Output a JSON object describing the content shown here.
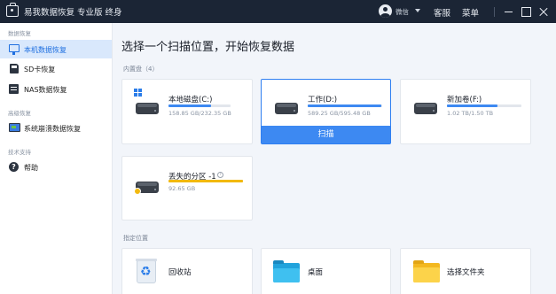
{
  "titlebar": {
    "app_title": "易我数据恢复 专业版 终身",
    "user_name": "微信",
    "links": [
      "客服",
      "菜单"
    ]
  },
  "sidebar": {
    "sections": [
      "数据恢复",
      "高级恢复",
      "技术支持"
    ],
    "items": [
      {
        "label": "本机数据恢复",
        "icon": "computer-icon",
        "active": true
      },
      {
        "label": "SD卡恢复",
        "icon": "sd-card-icon",
        "active": false
      },
      {
        "label": "NAS数据恢复",
        "icon": "nas-icon",
        "active": false
      },
      {
        "label": "系统崩溃数据恢复",
        "icon": "system-crash-icon",
        "active": false
      },
      {
        "label": "帮助",
        "icon": "help-icon",
        "active": false
      }
    ]
  },
  "main": {
    "title": "选择一个扫描位置，开始恢复数据",
    "builtin_label": "内置盘（4）",
    "location_label": "指定位置",
    "scan_label": "扫描",
    "drives": [
      {
        "name": "本地磁盘(C:)",
        "size": "158.85 GB/232.35 GB",
        "used": 0.68
      },
      {
        "name": "工作(D:)",
        "size": "589.25 GB/595.48 GB",
        "used": 0.99
      },
      {
        "name": "新加卷(F:)",
        "size": "1.02 TB/1.50 TB",
        "used": 0.68
      },
      {
        "name": "丢失的分区 -1",
        "size": "92.65 GB",
        "used": 1.0,
        "help": "?"
      }
    ],
    "locations": [
      {
        "name": "回收站",
        "icon": "recycle-bin-icon"
      },
      {
        "name": "桌面",
        "icon": "desktop-folder-icon"
      },
      {
        "name": "选择文件夹",
        "icon": "folder-icon"
      }
    ]
  },
  "colors": {
    "accent": "#3d89f2",
    "titlebar": "#1b2535",
    "lost_partition": "#f2b90f"
  }
}
